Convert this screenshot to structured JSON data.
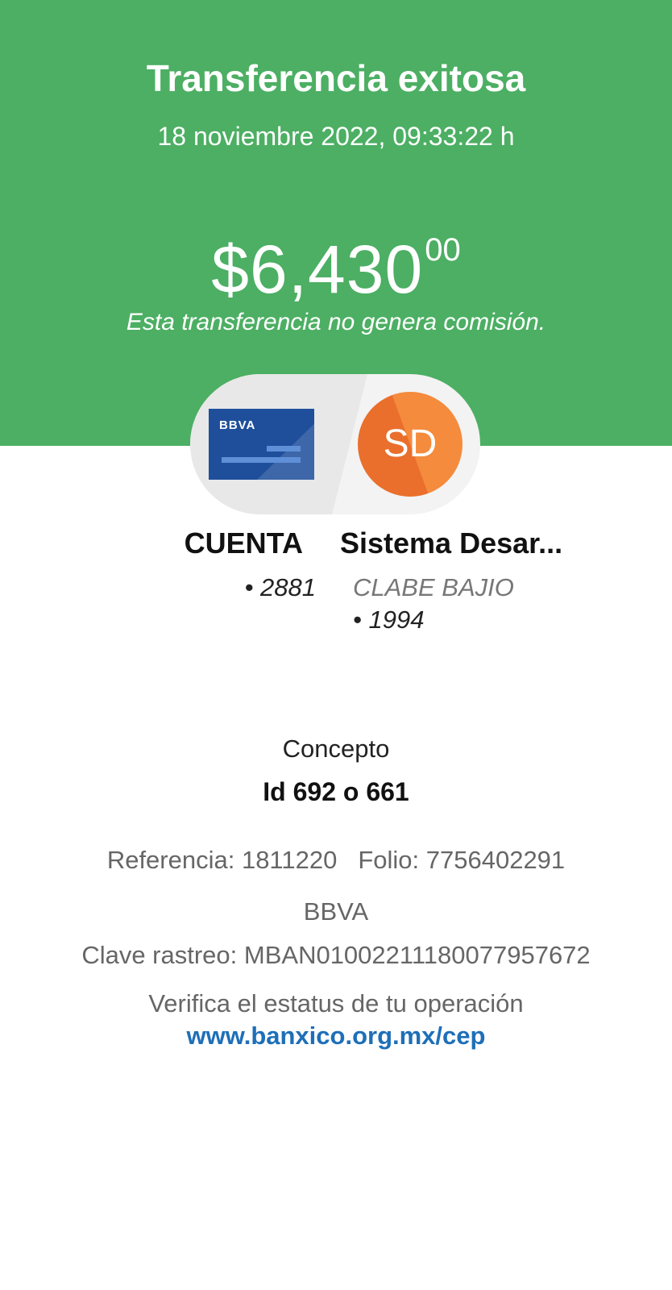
{
  "header": {
    "title": "Transferencia exitosa",
    "datetime": "18 noviembre 2022, 09:33:22 h",
    "amount_main": "$6,430",
    "amount_cents": "00",
    "commission_note": "Esta transferencia no genera comisión.",
    "background_color": "#4caf63"
  },
  "origin": {
    "card_logo": "BBVA",
    "name": "CUENTA",
    "account": "• 2881"
  },
  "destination": {
    "initials": "SD",
    "name": "Sistema Desar...",
    "bank": "CLABE BAJIO",
    "account": "• 1994"
  },
  "details": {
    "concept_label": "Concepto",
    "concept_value": "Id 692 o 661",
    "reference": "Referencia: 1811220",
    "folio": "Folio: 7756402291",
    "bank": "BBVA",
    "tracking_key": "Clave rastreo: MBAN01002211180077957672",
    "verify_text": "Verifica el estatus de tu operación",
    "verify_link": "www.banxico.org.mx/cep",
    "link_color": "#1e6fb8"
  }
}
